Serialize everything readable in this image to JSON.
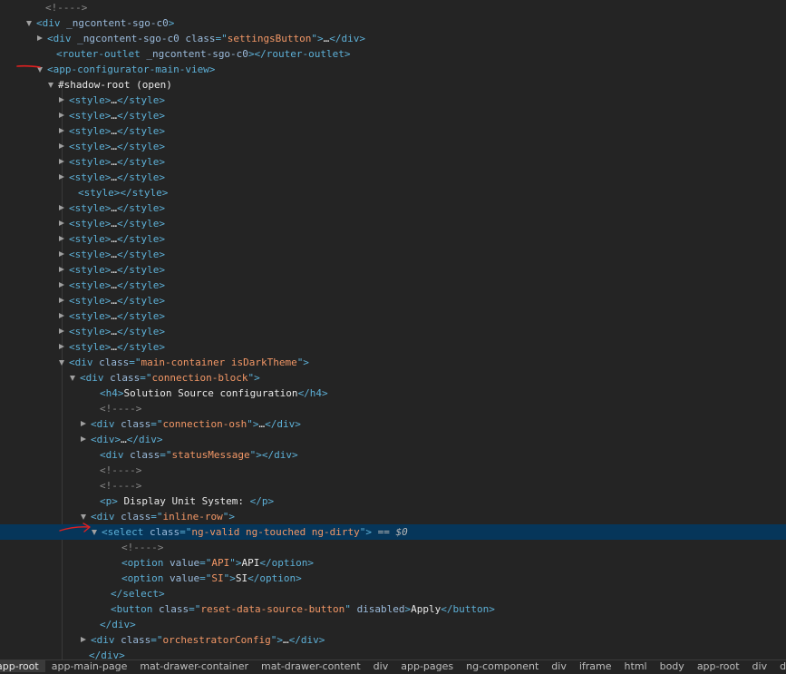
{
  "colors": {
    "tag": "#5db0d7",
    "attr_name": "#9bbbdc",
    "attr_value": "#f29766",
    "text": "#e8e8e8",
    "comment": "#898989",
    "selected_bg": "#06365a",
    "annotation": "#e02020"
  },
  "rows": [
    {
      "caret": "none",
      "parts": [
        [
          "cm",
          "<!---->"
        ]
      ]
    },
    {
      "caret": "open",
      "parts": [
        [
          "tg",
          "<div "
        ],
        [
          "an",
          "_ngcontent-sgo-c0"
        ],
        [
          "tg",
          ">"
        ]
      ]
    },
    {
      "caret": "closed",
      "parts": [
        [
          "tg",
          "<div "
        ],
        [
          "an",
          "_ngcontent-sgo-c0 class"
        ],
        [
          "tg",
          "=\""
        ],
        [
          "av",
          "settingsButton"
        ],
        [
          "tg",
          "\">"
        ],
        [
          "tx",
          "…"
        ],
        [
          "tg",
          "</div>"
        ]
      ]
    },
    {
      "caret": "none",
      "parts": [
        [
          "tg",
          "<router-outlet "
        ],
        [
          "an",
          "_ngcontent-sgo-c0"
        ],
        [
          "tg",
          "></router-outlet>"
        ]
      ]
    },
    {
      "caret": "open",
      "parts": [
        [
          "tg",
          "<app-configurator-main-view>"
        ]
      ]
    },
    {
      "caret": "open",
      "parts": [
        [
          "sr",
          "#shadow-root (open)"
        ]
      ]
    },
    {
      "caret": "closed",
      "parts": [
        [
          "tg",
          "<style>"
        ],
        [
          "tx",
          "…"
        ],
        [
          "tg",
          "</style>"
        ]
      ]
    },
    {
      "caret": "closed",
      "parts": [
        [
          "tg",
          "<style>"
        ],
        [
          "tx",
          "…"
        ],
        [
          "tg",
          "</style>"
        ]
      ]
    },
    {
      "caret": "closed",
      "parts": [
        [
          "tg",
          "<style>"
        ],
        [
          "tx",
          "…"
        ],
        [
          "tg",
          "</style>"
        ]
      ]
    },
    {
      "caret": "closed",
      "parts": [
        [
          "tg",
          "<style>"
        ],
        [
          "tx",
          "…"
        ],
        [
          "tg",
          "</style>"
        ]
      ]
    },
    {
      "caret": "closed",
      "parts": [
        [
          "tg",
          "<style>"
        ],
        [
          "tx",
          "…"
        ],
        [
          "tg",
          "</style>"
        ]
      ]
    },
    {
      "caret": "closed",
      "parts": [
        [
          "tg",
          "<style>"
        ],
        [
          "tx",
          "…"
        ],
        [
          "tg",
          "</style>"
        ]
      ]
    },
    {
      "caret": "none",
      "parts": [
        [
          "tg",
          "<style></style>"
        ]
      ]
    },
    {
      "caret": "closed",
      "parts": [
        [
          "tg",
          "<style>"
        ],
        [
          "tx",
          "…"
        ],
        [
          "tg",
          "</style>"
        ]
      ]
    },
    {
      "caret": "closed",
      "parts": [
        [
          "tg",
          "<style>"
        ],
        [
          "tx",
          "…"
        ],
        [
          "tg",
          "</style>"
        ]
      ]
    },
    {
      "caret": "closed",
      "parts": [
        [
          "tg",
          "<style>"
        ],
        [
          "tx",
          "…"
        ],
        [
          "tg",
          "</style>"
        ]
      ]
    },
    {
      "caret": "closed",
      "parts": [
        [
          "tg",
          "<style>"
        ],
        [
          "tx",
          "…"
        ],
        [
          "tg",
          "</style>"
        ]
      ]
    },
    {
      "caret": "closed",
      "parts": [
        [
          "tg",
          "<style>"
        ],
        [
          "tx",
          "…"
        ],
        [
          "tg",
          "</style>"
        ]
      ]
    },
    {
      "caret": "closed",
      "parts": [
        [
          "tg",
          "<style>"
        ],
        [
          "tx",
          "…"
        ],
        [
          "tg",
          "</style>"
        ]
      ]
    },
    {
      "caret": "closed",
      "parts": [
        [
          "tg",
          "<style>"
        ],
        [
          "tx",
          "…"
        ],
        [
          "tg",
          "</style>"
        ]
      ]
    },
    {
      "caret": "closed",
      "parts": [
        [
          "tg",
          "<style>"
        ],
        [
          "tx",
          "…"
        ],
        [
          "tg",
          "</style>"
        ]
      ]
    },
    {
      "caret": "closed",
      "parts": [
        [
          "tg",
          "<style>"
        ],
        [
          "tx",
          "…"
        ],
        [
          "tg",
          "</style>"
        ]
      ]
    },
    {
      "caret": "closed",
      "parts": [
        [
          "tg",
          "<style>"
        ],
        [
          "tx",
          "…"
        ],
        [
          "tg",
          "</style>"
        ]
      ]
    },
    {
      "caret": "open",
      "parts": [
        [
          "tg",
          "<div "
        ],
        [
          "an",
          "class"
        ],
        [
          "tg",
          "=\""
        ],
        [
          "av",
          "main-container isDarkTheme"
        ],
        [
          "tg",
          "\">"
        ]
      ]
    },
    {
      "caret": "open",
      "parts": [
        [
          "tg",
          "<div "
        ],
        [
          "an",
          "class"
        ],
        [
          "tg",
          "=\""
        ],
        [
          "av",
          "connection-block"
        ],
        [
          "tg",
          "\">"
        ]
      ]
    },
    {
      "caret": "none",
      "parts": [
        [
          "tg",
          "<h4>"
        ],
        [
          "tx",
          "Solution Source configuration"
        ],
        [
          "tg",
          "</h4>"
        ]
      ]
    },
    {
      "caret": "none",
      "parts": [
        [
          "cm",
          "<!---->"
        ]
      ]
    },
    {
      "caret": "closed",
      "parts": [
        [
          "tg",
          "<div "
        ],
        [
          "an",
          "class"
        ],
        [
          "tg",
          "=\""
        ],
        [
          "av",
          "connection-osh"
        ],
        [
          "tg",
          "\">"
        ],
        [
          "tx",
          "…"
        ],
        [
          "tg",
          "</div>"
        ]
      ]
    },
    {
      "caret": "closed",
      "parts": [
        [
          "tg",
          "<div>"
        ],
        [
          "tx",
          "…"
        ],
        [
          "tg",
          "</div>"
        ]
      ]
    },
    {
      "caret": "none",
      "parts": [
        [
          "tg",
          "<div "
        ],
        [
          "an",
          "class"
        ],
        [
          "tg",
          "=\""
        ],
        [
          "av",
          "statusMessage"
        ],
        [
          "tg",
          "\"></div>"
        ]
      ]
    },
    {
      "caret": "none",
      "parts": [
        [
          "cm",
          "<!---->"
        ]
      ]
    },
    {
      "caret": "none",
      "parts": [
        [
          "cm",
          "<!---->"
        ]
      ]
    },
    {
      "caret": "none",
      "parts": [
        [
          "tg",
          "<p>"
        ],
        [
          "tx",
          " Display Unit System: "
        ],
        [
          "tg",
          "</p>"
        ]
      ]
    },
    {
      "caret": "open",
      "parts": [
        [
          "tg",
          "<div "
        ],
        [
          "an",
          "class"
        ],
        [
          "tg",
          "=\""
        ],
        [
          "av",
          "inline-row"
        ],
        [
          "tg",
          "\">"
        ]
      ]
    },
    {
      "caret": "open",
      "selected": true,
      "parts": [
        [
          "tg",
          "<select "
        ],
        [
          "an",
          "class"
        ],
        [
          "tg",
          "=\""
        ],
        [
          "av",
          "ng-valid ng-touched ng-dirty"
        ],
        [
          "tg",
          "\">"
        ],
        [
          "sel-suffix",
          " == "
        ],
        [
          "sel-var",
          "$0"
        ]
      ]
    },
    {
      "caret": "none",
      "parts": [
        [
          "cm",
          "<!---->"
        ]
      ]
    },
    {
      "caret": "none",
      "parts": [
        [
          "tg",
          "<option "
        ],
        [
          "an",
          "value"
        ],
        [
          "tg",
          "=\""
        ],
        [
          "av",
          "API"
        ],
        [
          "tg",
          "\">"
        ],
        [
          "tx",
          "API"
        ],
        [
          "tg",
          "</option>"
        ]
      ]
    },
    {
      "caret": "none",
      "parts": [
        [
          "tg",
          "<option "
        ],
        [
          "an",
          "value"
        ],
        [
          "tg",
          "=\""
        ],
        [
          "av",
          "SI"
        ],
        [
          "tg",
          "\">"
        ],
        [
          "tx",
          "SI"
        ],
        [
          "tg",
          "</option>"
        ]
      ]
    },
    {
      "caret": "none",
      "parts": [
        [
          "tg",
          "</select>"
        ]
      ]
    },
    {
      "caret": "none",
      "parts": [
        [
          "tg",
          "<button "
        ],
        [
          "an",
          "class"
        ],
        [
          "tg",
          "=\""
        ],
        [
          "av",
          "reset-data-source-button"
        ],
        [
          "tg",
          "\" "
        ],
        [
          "an",
          "disabled"
        ],
        [
          "tg",
          ">"
        ],
        [
          "tx",
          "Apply"
        ],
        [
          "tg",
          "</button>"
        ]
      ]
    },
    {
      "caret": "none",
      "parts": [
        [
          "tg",
          "</div>"
        ]
      ]
    },
    {
      "caret": "closed",
      "parts": [
        [
          "tg",
          "<div "
        ],
        [
          "an",
          "class"
        ],
        [
          "tg",
          "=\""
        ],
        [
          "av",
          "orchestratorConfig"
        ],
        [
          "tg",
          "\">"
        ],
        [
          "tx",
          "…"
        ],
        [
          "tg",
          "</div>"
        ]
      ]
    },
    {
      "caret": "none",
      "parts": [
        [
          "tg",
          "</div>"
        ]
      ]
    }
  ],
  "breadcrumbs": [
    "app-root",
    "app-main-page",
    "mat-drawer-container",
    "mat-drawer-content",
    "div",
    "app-pages",
    "ng-component",
    "div",
    "iframe",
    "html",
    "body",
    "app-root",
    "div",
    "div"
  ]
}
